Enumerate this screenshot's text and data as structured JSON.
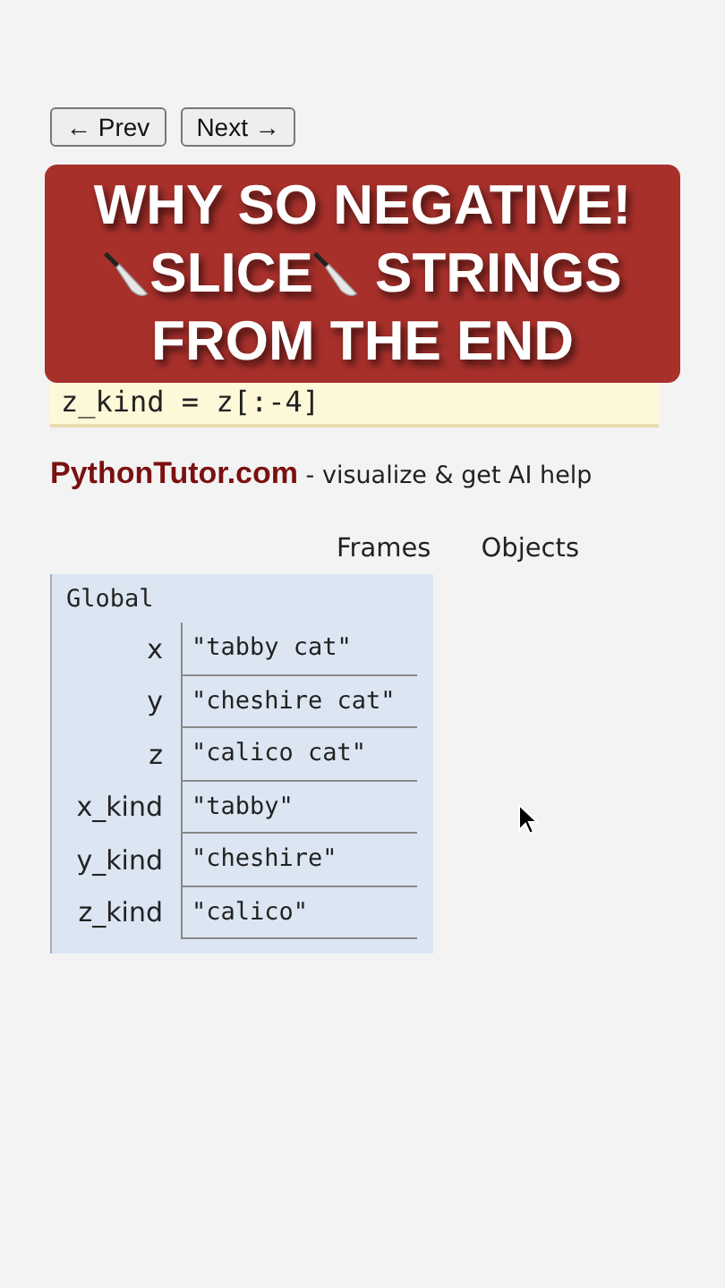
{
  "nav": {
    "prev": "← Prev",
    "next": "Next →"
  },
  "code": [
    "z_kind = z[:-4]"
  ],
  "banner": {
    "lines": [
      [
        {
          "kind": "text",
          "text": "WHY SO NEGATIVE!"
        }
      ],
      [
        {
          "kind": "knife"
        },
        {
          "kind": "text",
          "text": "SLICE"
        },
        {
          "kind": "knife"
        },
        {
          "kind": "text",
          "text": " STRINGS"
        }
      ],
      [
        {
          "kind": "text",
          "text": "FROM THE END"
        }
      ]
    ]
  },
  "brand": {
    "name": "PythonTutor.com",
    "tagline": " - visualize & get AI help"
  },
  "headers": {
    "frames": "Frames",
    "objects": "Objects"
  },
  "frame": {
    "title": "Global",
    "vars": [
      {
        "name": "x",
        "value": "\"tabby cat\""
      },
      {
        "name": "y",
        "value": "\"cheshire cat\""
      },
      {
        "name": "z",
        "value": "\"calico cat\""
      },
      {
        "name": "x_kind",
        "value": "\"tabby\""
      },
      {
        "name": "y_kind",
        "value": "\"cheshire\""
      },
      {
        "name": "z_kind",
        "value": "\"calico\""
      }
    ]
  }
}
